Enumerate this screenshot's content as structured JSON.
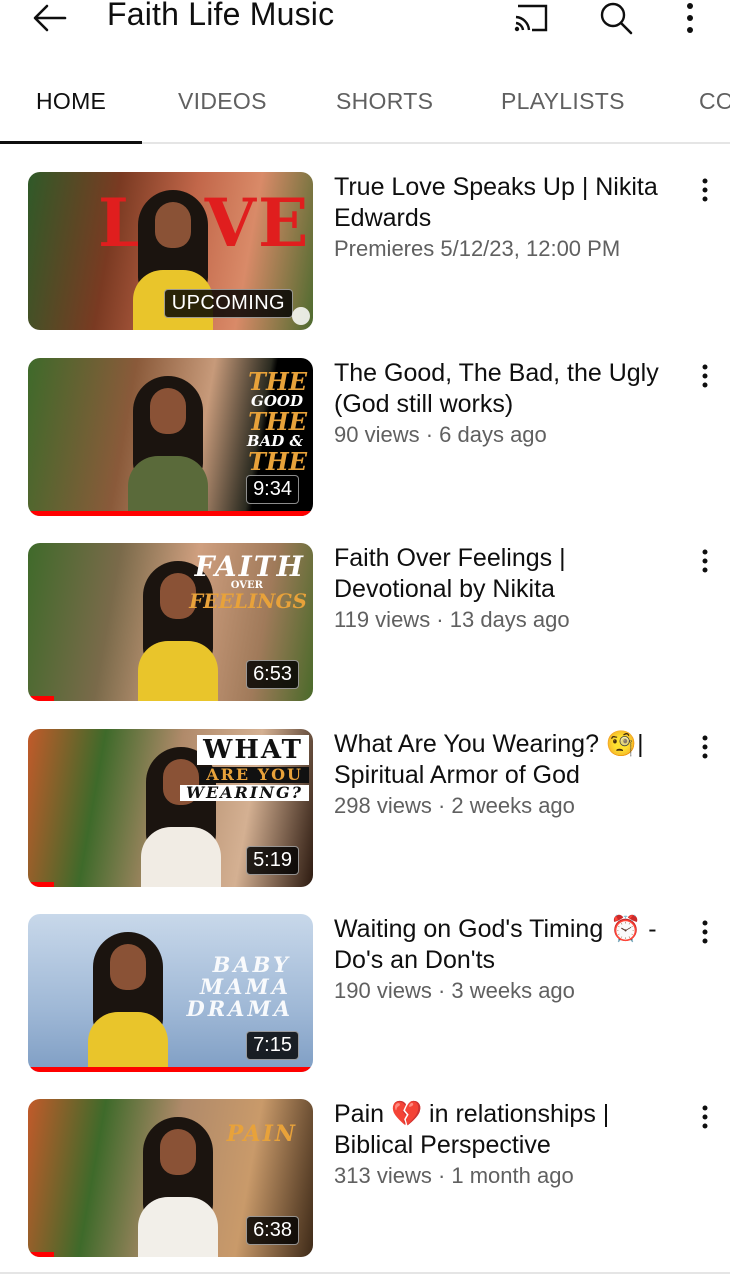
{
  "header": {
    "title": "Faith Life Music",
    "back_icon": "arrow-left-icon",
    "cast_icon": "cast-icon",
    "search_icon": "search-icon",
    "more_icon": "more-vert-icon"
  },
  "tabs": [
    {
      "label": "HOME",
      "active": true
    },
    {
      "label": "VIDEOS",
      "active": false
    },
    {
      "label": "SHORTS",
      "active": false
    },
    {
      "label": "PLAYLISTS",
      "active": false
    },
    {
      "label": "CO",
      "active": false
    }
  ],
  "videos": [
    {
      "title": "True Love Speaks Up | Nikita Edwards",
      "subtitle": "Premieres 5/12/23, 12:00 PM",
      "badge": "UPCOMING",
      "thumb_text": [
        "LOVE"
      ],
      "watched_fraction": 0
    },
    {
      "title": "The Good, The Bad, the Ugly (God still works)",
      "subtitle": "90 views · 6 days ago",
      "duration": "9:34",
      "thumb_text": [
        "THE",
        "GOOD",
        "THE",
        "BAD &",
        "THE"
      ],
      "watched_fraction": 1
    },
    {
      "title": "Faith Over Feelings | Devotional by Nikita",
      "subtitle": "119 views · 13 days ago",
      "duration": "6:53",
      "thumb_text": [
        "FAITH",
        "OVER",
        "FEELINGS"
      ],
      "watched_fraction": 0.09
    },
    {
      "title": "What Are You Wearing? 🧐| Spiritual Armor of God",
      "subtitle": "298 views · 2 weeks ago",
      "duration": "5:19",
      "thumb_text": [
        "WHAT",
        "ARE YOU",
        "WEARING?"
      ],
      "watched_fraction": 0.09
    },
    {
      "title": "Waiting on God's Timing ⏰ -Do's an Don'ts",
      "subtitle": "190 views · 3 weeks ago",
      "duration": "7:15",
      "thumb_text": [
        "BABY",
        "MAMA",
        "DRAMA"
      ],
      "watched_fraction": 1
    },
    {
      "title": "Pain 💔 in relationships | Biblical Perspective",
      "subtitle": "313 views · 1 month ago",
      "duration": "6:38",
      "thumb_text": [
        "PAIN"
      ],
      "watched_fraction": 0.09
    }
  ],
  "colors": {
    "accent_red": "#ff0000",
    "text_primary": "#0f0f0f",
    "text_secondary": "#606060",
    "divider": "#e5e5e5"
  }
}
